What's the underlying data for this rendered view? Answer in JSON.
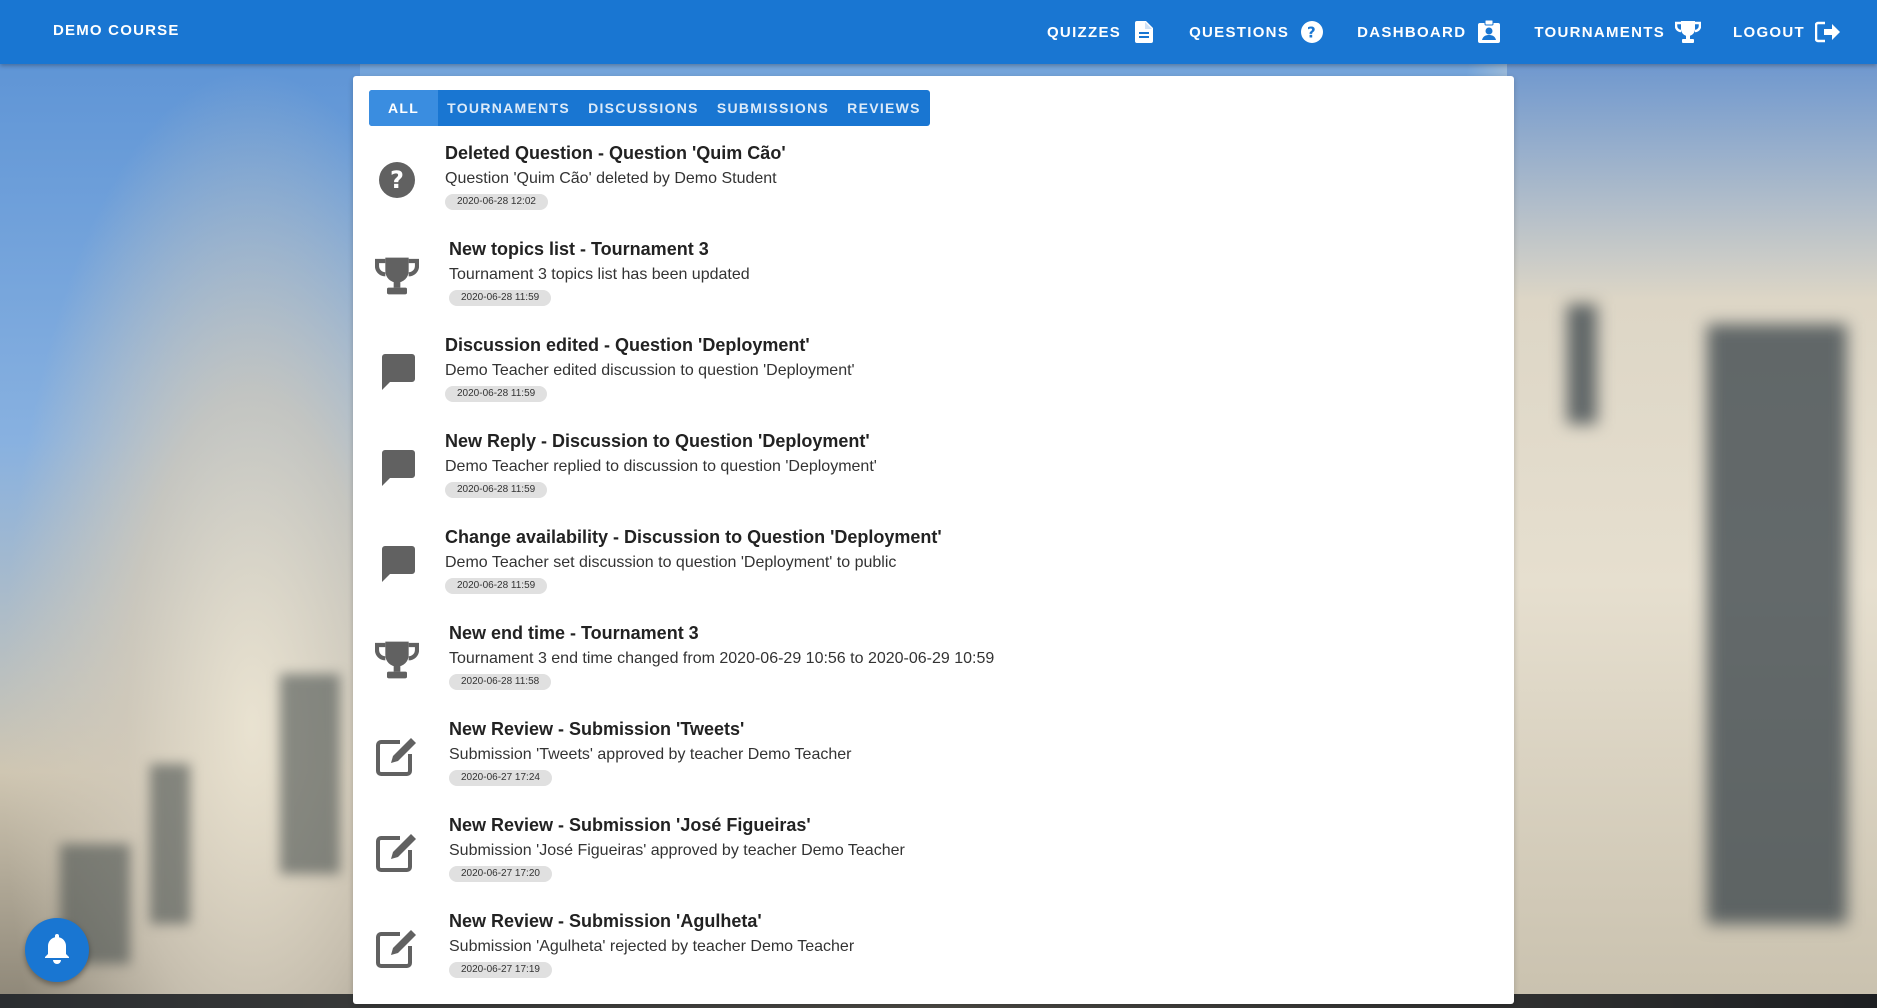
{
  "app": {
    "course_title": "DEMO COURSE"
  },
  "nav": {
    "quizzes": "QUIZZES",
    "questions": "QUESTIONS",
    "dashboard": "DASHBOARD",
    "tournaments": "TOURNAMENTS",
    "logout": "LOGOUT"
  },
  "tabs": {
    "all": "ALL",
    "tournaments": "TOURNAMENTS",
    "discussions": "DISCUSSIONS",
    "submissions": "SUBMISSIONS",
    "reviews": "REVIEWS",
    "active": "ALL"
  },
  "notifications": [
    {
      "icon": "question-circle-icon",
      "title": "Deleted Question - Question 'Quim Cão'",
      "desc": "Question 'Quim Cão' deleted by Demo Student",
      "date": "2020-06-28 12:02"
    },
    {
      "icon": "trophy-icon",
      "title": "New topics list - Tournament 3",
      "desc": "Tournament 3 topics list has been updated",
      "date": "2020-06-28 11:59"
    },
    {
      "icon": "comment-icon",
      "title": "Discussion edited - Question 'Deployment'",
      "desc": "Demo Teacher edited discussion to question 'Deployment'",
      "date": "2020-06-28 11:59"
    },
    {
      "icon": "comment-icon",
      "title": "New Reply - Discussion to Question 'Deployment'",
      "desc": "Demo Teacher replied to discussion to question 'Deployment'",
      "date": "2020-06-28 11:59"
    },
    {
      "icon": "comment-icon",
      "title": "Change availability - Discussion to Question 'Deployment'",
      "desc": "Demo Teacher set discussion to question 'Deployment' to public",
      "date": "2020-06-28 11:59"
    },
    {
      "icon": "trophy-icon",
      "title": "New end time - Tournament 3",
      "desc": "Tournament 3 end time changed from 2020-06-29 10:56 to 2020-06-29 10:59",
      "date": "2020-06-28 11:58"
    },
    {
      "icon": "edit-icon",
      "title": "New Review - Submission 'Tweets'",
      "desc": "Submission 'Tweets' approved by teacher Demo Teacher",
      "date": "2020-06-27 17:24"
    },
    {
      "icon": "edit-icon",
      "title": "New Review - Submission 'José Figueiras'",
      "desc": "Submission 'José Figueiras' approved by teacher Demo Teacher",
      "date": "2020-06-27 17:20"
    },
    {
      "icon": "edit-icon",
      "title": "New Review - Submission 'Agulheta'",
      "desc": "Submission 'Agulheta' rejected by teacher Demo Teacher",
      "date": "2020-06-27 17:19"
    }
  ],
  "colors": {
    "primary": "#1976d2",
    "icon_grey": "#616161"
  }
}
